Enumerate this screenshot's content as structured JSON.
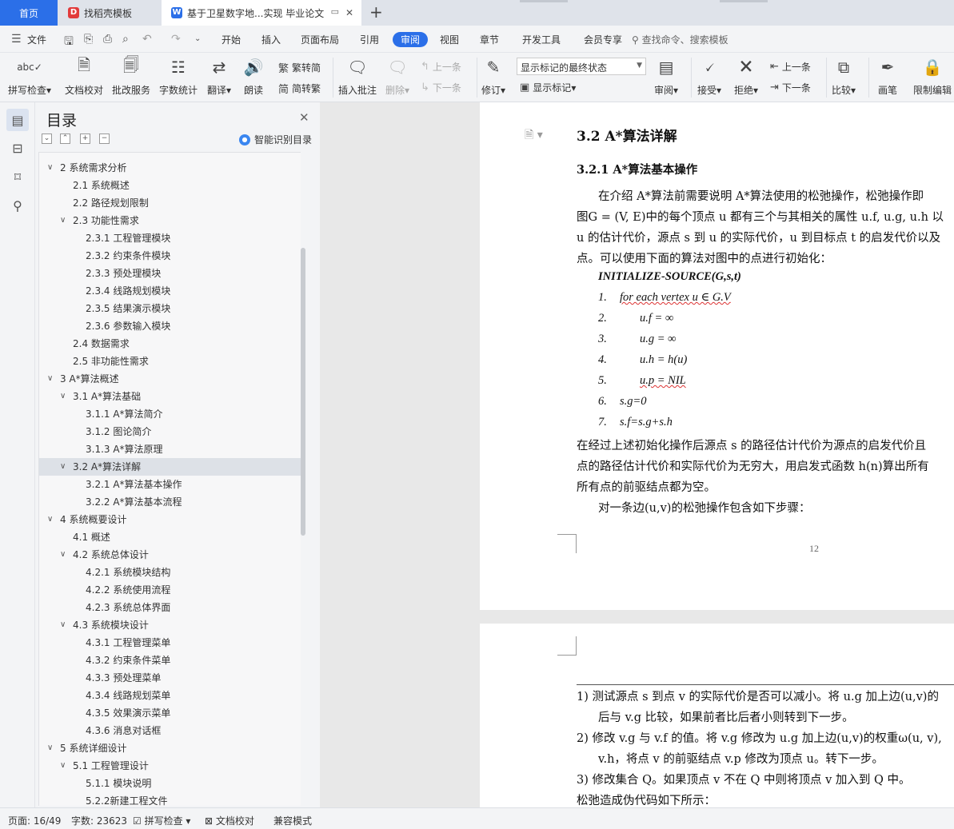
{
  "tabs": {
    "home": "首页",
    "template": "找稻壳模板",
    "document": "基于卫星数字地...实现 毕业论文"
  },
  "menu": {
    "file": "文件",
    "items": [
      "开始",
      "插入",
      "页面布局",
      "引用",
      "审阅",
      "视图",
      "章节",
      "开发工具",
      "会员专享"
    ],
    "active": "审阅",
    "search": "查找命令、搜索模板"
  },
  "ribbon": {
    "spell_check": "拼写检查",
    "doc_proof": "文档校对",
    "annotate_service": "批改服务",
    "word_count": "字数统计",
    "translate": "翻译",
    "read_aloud": "朗读",
    "to_traditional": "繁转简",
    "to_simplified": "简转繁",
    "insert_comment": "插入批注",
    "delete": "删除",
    "prev_comment": "上一条",
    "next_comment": "下一条",
    "revise": "修订",
    "markup_select": "显示标记的最终状态",
    "show_markup": "显示标记",
    "review": "审阅",
    "accept": "接受",
    "reject": "拒绝",
    "prev_change": "上一条",
    "next_change": "下一条",
    "compare": "比较",
    "pen": "画笔",
    "restrict_edit": "限制编辑"
  },
  "toc": {
    "title": "目录",
    "smart": "智能识别目录",
    "items": [
      {
        "text": "2  系统需求分析",
        "level": 1,
        "arrow": true
      },
      {
        "text": "2.1  系统概述",
        "level": 2,
        "arrow": false
      },
      {
        "text": "2.2  路径规划限制",
        "level": 2,
        "arrow": false
      },
      {
        "text": "2.3  功能性需求",
        "level": 2,
        "arrow": true
      },
      {
        "text": "2.3.1  工程管理模块",
        "level": 3,
        "arrow": false
      },
      {
        "text": "2.3.2  约束条件模块",
        "level": 3,
        "arrow": false
      },
      {
        "text": "2.3.3  预处理模块",
        "level": 3,
        "arrow": false
      },
      {
        "text": "2.3.4  线路规划模块",
        "level": 3,
        "arrow": false
      },
      {
        "text": "2.3.5  结果演示模块",
        "level": 3,
        "arrow": false
      },
      {
        "text": "2.3.6  参数输入模块",
        "level": 3,
        "arrow": false
      },
      {
        "text": "2.4  数据需求",
        "level": 2,
        "arrow": false
      },
      {
        "text": "2.5  非功能性需求",
        "level": 2,
        "arrow": false
      },
      {
        "text": "3 A*算法概述",
        "level": 1,
        "arrow": true
      },
      {
        "text": "3.1 A*算法基础",
        "level": 2,
        "arrow": true
      },
      {
        "text": "3.1.1 A*算法简介",
        "level": 3,
        "arrow": false
      },
      {
        "text": "3.1.2  图论简介",
        "level": 3,
        "arrow": false
      },
      {
        "text": "3.1.3 A*算法原理",
        "level": 3,
        "arrow": false
      },
      {
        "text": "3.2 A*算法详解",
        "level": 2,
        "arrow": true,
        "selected": true
      },
      {
        "text": "3.2.1 A*算法基本操作",
        "level": 3,
        "arrow": false
      },
      {
        "text": "3.2.2 A*算法基本流程",
        "level": 3,
        "arrow": false
      },
      {
        "text": "4  系统概要设计",
        "level": 1,
        "arrow": true
      },
      {
        "text": "4.1  概述",
        "level": 2,
        "arrow": false
      },
      {
        "text": "4.2  系统总体设计",
        "level": 2,
        "arrow": true
      },
      {
        "text": "4.2.1  系统模块结构",
        "level": 3,
        "arrow": false
      },
      {
        "text": "4.2.2  系统使用流程",
        "level": 3,
        "arrow": false
      },
      {
        "text": "4.2.3  系统总体界面",
        "level": 3,
        "arrow": false
      },
      {
        "text": "4.3  系统模块设计",
        "level": 2,
        "arrow": true
      },
      {
        "text": "4.3.1  工程管理菜单",
        "level": 3,
        "arrow": false
      },
      {
        "text": "4.3.2  约束条件菜单",
        "level": 3,
        "arrow": false
      },
      {
        "text": "4.3.3  预处理菜单",
        "level": 3,
        "arrow": false
      },
      {
        "text": "4.3.4  线路规划菜单",
        "level": 3,
        "arrow": false
      },
      {
        "text": "4.3.5  效果演示菜单",
        "level": 3,
        "arrow": false
      },
      {
        "text": "4.3.6  消息对话框",
        "level": 3,
        "arrow": false
      },
      {
        "text": "5  系统详细设计",
        "level": 1,
        "arrow": true
      },
      {
        "text": "5.1  工程管理设计",
        "level": 2,
        "arrow": true
      },
      {
        "text": "5.1.1  模块说明",
        "level": 3,
        "arrow": false
      },
      {
        "text": "5.2.2新建工程文件",
        "level": 3,
        "arrow": false
      }
    ]
  },
  "doc": {
    "h2": "3.2  A*算法详解",
    "h3": "3.2.1  A*算法基本操作",
    "para1": [
      "在介绍 A*算法前需要说明 A*算法使用的松弛操作，松弛操作即",
      "图G = (V, E)中的每个顶点 u 都有三个与其相关的属性 u.f,  u.g,  u.h 以",
      "u 的估计代价，源点 s 到 u 的实际代价，u 到目标点 t 的启发代价以及",
      "点。可以使用下面的算法对图中的点进行初始化："
    ],
    "code_head": "INITIALIZE-SOURCE(G,s,t)",
    "code": [
      {
        "n": "1.",
        "t": "for each vertex  u ∈ G.V"
      },
      {
        "n": "2.",
        "t": "u.f = ∞"
      },
      {
        "n": "3.",
        "t": "u.g = ∞"
      },
      {
        "n": "4.",
        "t": "u.h = h(u)"
      },
      {
        "n": "5.",
        "t": "u.p = NIL"
      },
      {
        "n": "6.",
        "t": "s.g=0"
      },
      {
        "n": "7.",
        "t": "s.f=s.g+s.h"
      }
    ],
    "para2": [
      "在经过上述初始化操作后源点 s 的路径估计代价为源点的启发代价且",
      "点的路径估计代价和实际代价为无穷大，用启发式函数 h(n)算出所有",
      "所有点的前驱结点都为空。",
      "对一条边(u,v)的松弛操作包含如下步骤："
    ],
    "page_number": "12",
    "page2": [
      "1)   测试源点 s 到点 v 的实际代价是否可以减小。将 u.g 加上边(u,v)的",
      "后与 v.g 比较，如果前者比后者小则转到下一步。",
      "2)   修改 v.g 与 v.f 的值。将 v.g 修改为 u.g 加上边(u,v)的权重ω(u, v),",
      "v.h，将点 v 的前驱结点 v.p 修改为顶点 u。转下一步。",
      "3)   修改集合 Q。如果顶点 v 不在 Q 中则将顶点 v 加入到 Q 中。",
      "松弛造成伪代码如下所示："
    ]
  },
  "status": {
    "page": "页面: 16/49",
    "words": "字数: 23623",
    "spell": "拼写检查",
    "proof": "文档校对",
    "compat": "兼容模式"
  }
}
